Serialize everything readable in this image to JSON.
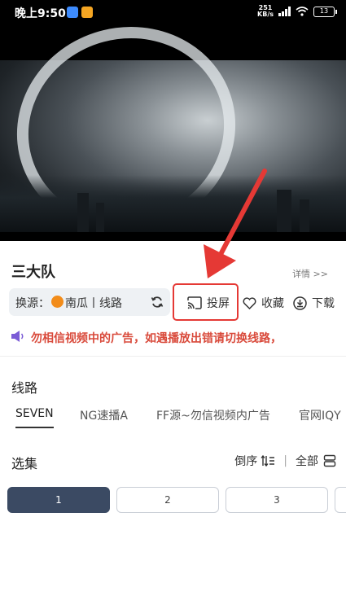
{
  "status_bar": {
    "time": "晚上9:50",
    "net_speed_top": "251",
    "net_speed_bottom": "KB/s",
    "battery": "13"
  },
  "detail": {
    "title": "三大队",
    "detail_link": "详情 >>"
  },
  "source": {
    "label": "换源：",
    "value": "南瓜丨线路"
  },
  "actions": {
    "cast": "投屏",
    "favorite": "收藏",
    "download": "下载"
  },
  "notice": {
    "text": "勿相信视频中的广告，如遇播放出错请切换线路，"
  },
  "routes": {
    "heading": "线路",
    "tabs": [
      "SEVEN",
      "NG速播A",
      "FF源~勿信视频内广告",
      "官网IQY"
    ]
  },
  "episodes": {
    "heading": "选集",
    "sort_label": "倒序",
    "all_label": "全部",
    "items": [
      "1",
      "2",
      "3"
    ]
  },
  "colors": {
    "accent": "#3b4a63",
    "highlight": "#e53935",
    "notice": "#d94a3b"
  }
}
